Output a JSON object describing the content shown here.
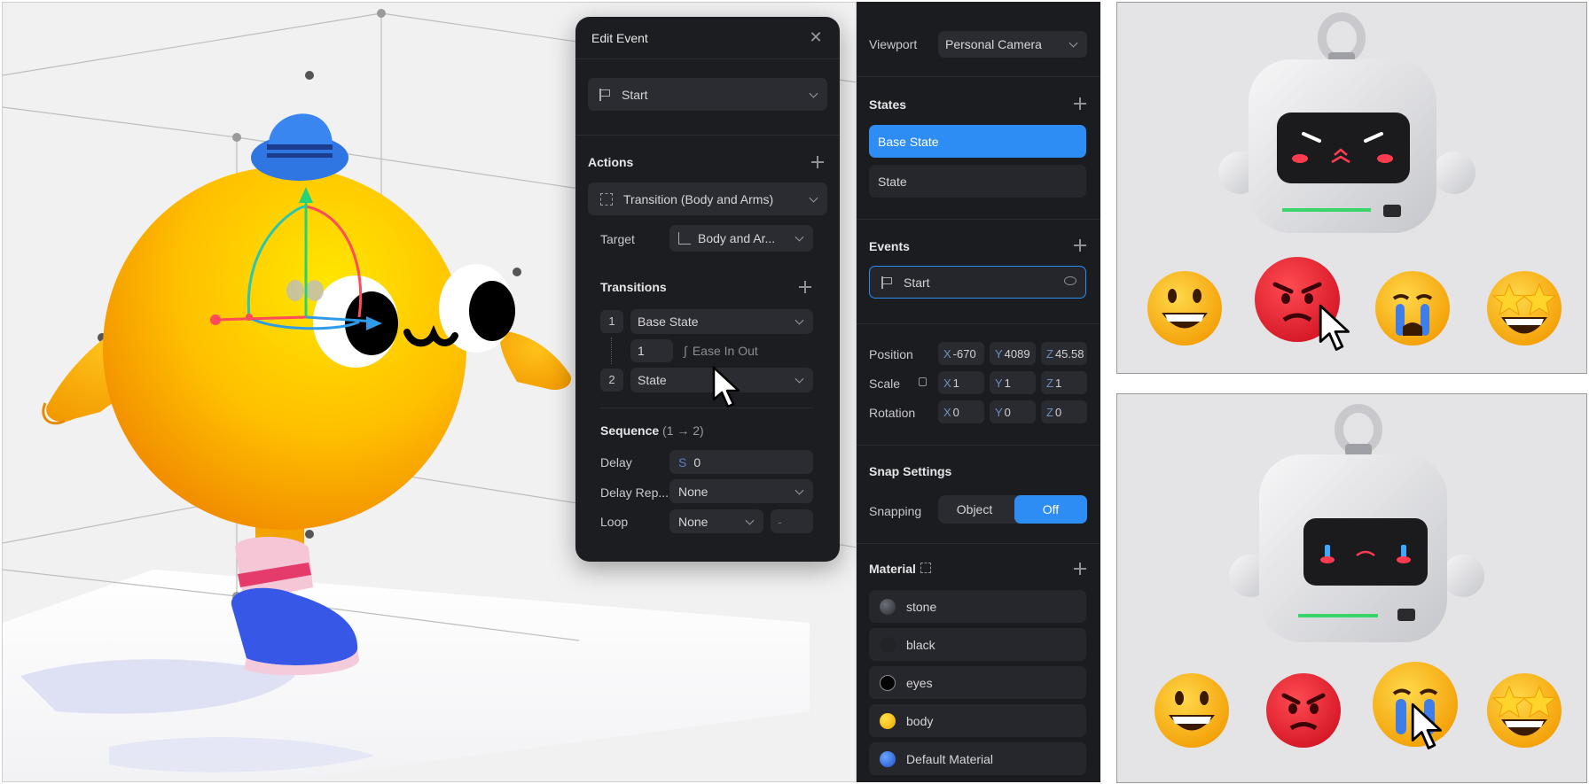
{
  "edit_event": {
    "title": "Edit Event",
    "trigger_value": "Start",
    "actions_heading": "Actions",
    "action_value": "Transition (Body and Arms)",
    "target_label": "Target",
    "target_value": "Body and Ar...",
    "transitions_heading": "Transitions",
    "transitions": [
      {
        "index": "1",
        "state": "Base State"
      },
      {
        "index": "2",
        "state": "State"
      }
    ],
    "transition_duration": "1",
    "transition_easing": "Ease In Out",
    "sequence_heading": "Sequence",
    "sequence_range": "(1 → 2)",
    "delay_label": "Delay",
    "delay_prefix": "S",
    "delay_value": "0",
    "delay_repeat_label": "Delay Rep...",
    "delay_repeat_value": "None",
    "loop_label": "Loop",
    "loop_value": "None",
    "loop_extra": "-"
  },
  "props": {
    "viewport_label": "Viewport",
    "viewport_value": "Personal Camera",
    "states_heading": "States",
    "states": [
      "Base State",
      "State"
    ],
    "events_heading": "Events",
    "event_item": "Start",
    "position_label": "Position",
    "position": {
      "x": "-670",
      "y": "4089",
      "z": "45.58"
    },
    "scale_label": "Scale",
    "scale": {
      "x": "1",
      "y": "1",
      "z": "1"
    },
    "rotation_label": "Rotation",
    "rotation": {
      "x": "0",
      "y": "0",
      "z": "0"
    },
    "axis_x": "X",
    "axis_y": "Y",
    "axis_z": "Z",
    "snap_heading": "Snap Settings",
    "snapping_label": "Snapping",
    "snap_object": "Object",
    "snap_off": "Off",
    "material_heading": "Material",
    "materials": [
      {
        "name": "stone",
        "color": "#3a3d44"
      },
      {
        "name": "black",
        "color": "#222326"
      },
      {
        "name": "eyes",
        "color": "#050505"
      },
      {
        "name": "body",
        "color": "#f5b800"
      },
      {
        "name": "Default Material",
        "color": "#2f6fe0"
      }
    ]
  },
  "colors": {
    "accent_blue": "#2e8cf5",
    "panel_bg": "#1b1c20",
    "character_yellow": "#f8b400",
    "emoji_angry": "#e3202b"
  },
  "icons": [
    "close-icon",
    "flag-icon",
    "chevron-down-icon",
    "plus-icon",
    "transition-icon",
    "target-icon",
    "curve-icon",
    "lock-icon",
    "visibility-icon",
    "expand-icon",
    "cursor-icon"
  ]
}
